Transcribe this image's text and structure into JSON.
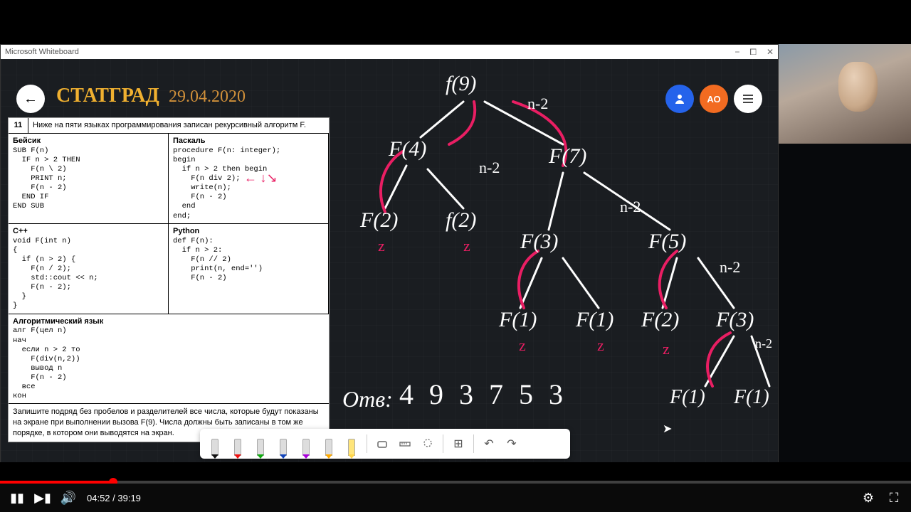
{
  "window": {
    "title": "Microsoft Whiteboard",
    "minimize": "−",
    "maximize": "⧠",
    "close": "✕"
  },
  "header": {
    "title": "СТАТГРАД",
    "date": "29.04.2020",
    "back_arrow": "←",
    "avatar_blue_icon": "person",
    "avatar_orange_label": "АО",
    "menu_label": "menu"
  },
  "problem": {
    "number": "11",
    "intro": "Ниже на пяти языках программирования записан рекурсивный алгоритм F.",
    "basic_title": "Бейсик",
    "basic_code": "SUB F(n)\n  IF n > 2 THEN\n    F(n \\ 2)\n    PRINT n;\n    F(n - 2)\n  END IF\nEND SUB",
    "pascal_title": "Паскаль",
    "pascal_code": "procedure F(n: integer);\nbegin\n  if n > 2 then begin\n    F(n div 2);\n    write(n);\n    F(n - 2)\n  end\nend;",
    "cpp_title": "С++",
    "cpp_code": "void F(int n)\n{\n  if (n > 2) {\n    F(n / 2);\n    std::cout << n;\n    F(n - 2);\n  }\n}",
    "python_title": "Python",
    "python_code": "def F(n):\n  if n > 2:\n    F(n // 2)\n    print(n, end='')\n    F(n - 2)",
    "alg_title": "Алгоритмический язык",
    "alg_code": "алг F(цел n)\nнач\n  если n > 2 то\n    F(div(n,2))\n    вывод n\n    F(n - 2)\n  все\nкон",
    "footer": "Запишите подряд без пробелов и разделителей все числа, которые будут показаны на экране при выполнении вызова F(9). Числа должны быть записаны в том же порядке, в котором они выводятся на экран."
  },
  "tree": {
    "f9": "f(9)",
    "f4": "F(4)",
    "f7": "F(7)",
    "f2a": "F(2)",
    "f2b": "f(2)",
    "f3a": "F(3)",
    "f5": "F(5)",
    "f1a": "F(1)",
    "f1b": "F(1)",
    "f2c": "F(2)",
    "f3b": "F(3)",
    "f1c": "F(1)",
    "f1d": "F(1)",
    "nm2a": "n-2",
    "nm2b": "n-2",
    "nm2c": "n-2",
    "nm2d": "n-2",
    "nm2e": "n-2",
    "z1": "z",
    "z2": "z",
    "z3": "z",
    "z4": "z",
    "z5": "z"
  },
  "answer": {
    "label": "Отв:",
    "value": "4 9 3 7 5 3"
  },
  "toolbar": {
    "pens": [
      {
        "tip": "#111"
      },
      {
        "tip": "#e11"
      },
      {
        "tip": "#1a1"
      },
      {
        "tip": "#14b"
      },
      {
        "tip": "#a0d"
      },
      {
        "tip": "#fa0"
      },
      {
        "tip": "#ffd54a"
      }
    ],
    "eraser": "eraser",
    "ruler": "ruler",
    "lasso": "lasso",
    "add": "⊞",
    "undo": "↶",
    "redo": "↷"
  },
  "player": {
    "play": "▮▮",
    "next": "▶▮",
    "volume": "🔊",
    "time": "04:52 / 39:19",
    "settings": "⚙",
    "fullscreen": "⛶"
  }
}
